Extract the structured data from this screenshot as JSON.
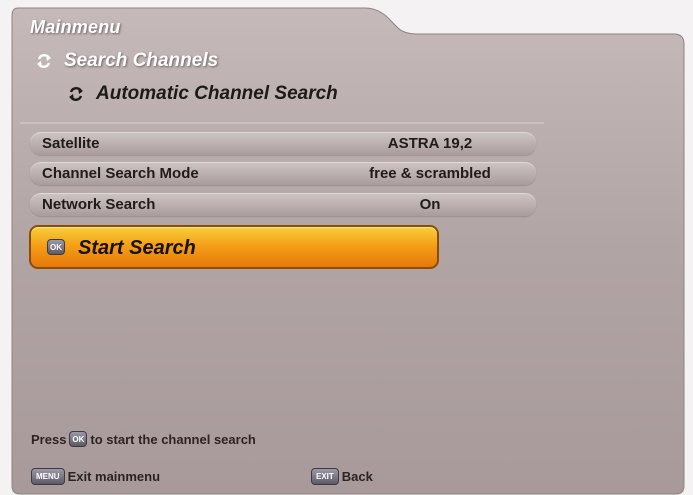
{
  "header": {
    "title": "Mainmenu",
    "breadcrumb": [
      {
        "label": "Search Channels",
        "icon": "circular-arrow-icon"
      },
      {
        "label": "Automatic Channel Search",
        "icon": "circular-arrow-icon"
      }
    ]
  },
  "settings": [
    {
      "label": "Satellite",
      "value": "ASTRA 19,2"
    },
    {
      "label": "Channel Search Mode",
      "value": "free & scrambled"
    },
    {
      "label": "Network Search",
      "value": "On"
    }
  ],
  "action": {
    "label": "Start Search",
    "key_label": "OK"
  },
  "hint": {
    "prefix": "Press",
    "key_label": "OK",
    "suffix": "to start the channel search"
  },
  "footer": {
    "exit": {
      "key_label": "MENU",
      "label": "Exit mainmenu"
    },
    "back": {
      "key_label": "EXIT",
      "label": "Back"
    }
  },
  "colors": {
    "panel": "#b3a6a6",
    "row": "#bcb1b1",
    "highlight": "#f4a018",
    "text_dark": "#201c1c",
    "title_white": "#ffffff"
  }
}
